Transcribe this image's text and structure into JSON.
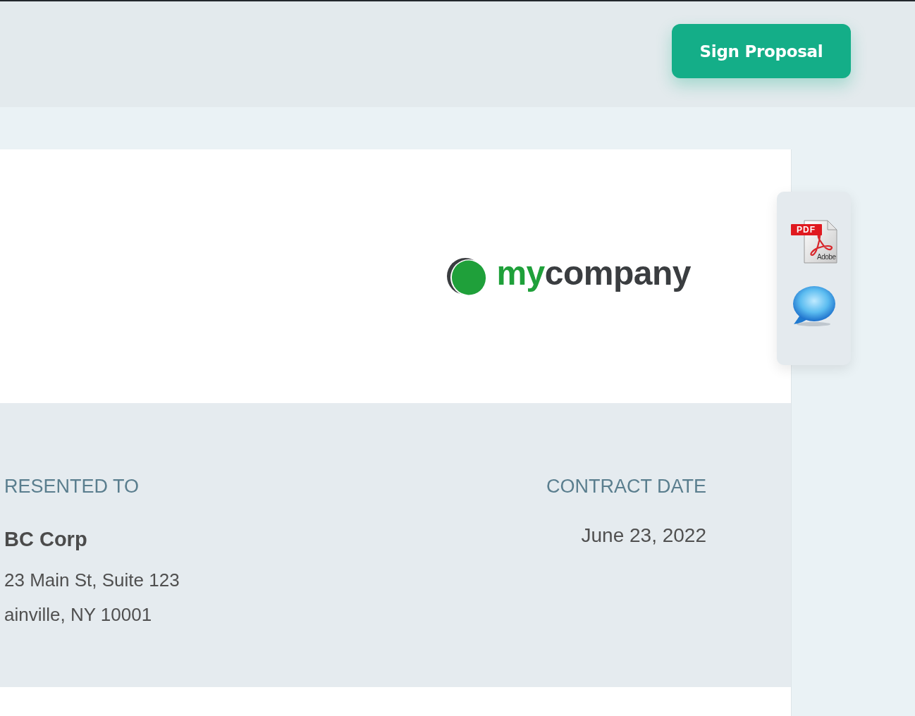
{
  "header": {
    "sign_button": "Sign Proposal"
  },
  "document": {
    "logo": {
      "accent": "my",
      "text": "company"
    },
    "info": {
      "presented_to": {
        "label": "RESENTED TO",
        "name": "BC Corp",
        "address": [
          "23 Main St, Suite 123",
          "ainville, NY 10001"
        ]
      },
      "contract_date": {
        "label": "CONTRACT DATE",
        "date": "June 23, 2022"
      }
    }
  },
  "side_toolbar": {
    "items": [
      {
        "kind": "pdf",
        "badge": "PDF",
        "caption": "Adobe"
      },
      {
        "kind": "chat"
      }
    ]
  }
}
